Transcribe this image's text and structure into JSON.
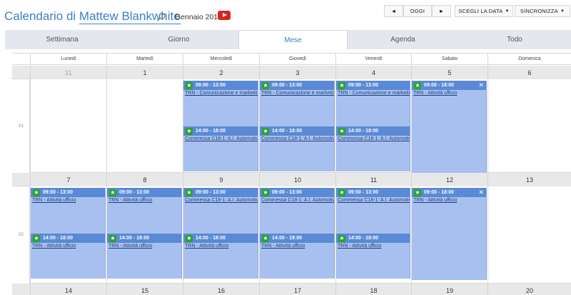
{
  "header": {
    "title_prefix": "Calendario di",
    "user_name": "Mattew Blankwhite",
    "month_label": "Gennaio 2019",
    "icons": {
      "search": "search-icon",
      "video": "youtube-icon"
    }
  },
  "toolbar": {
    "prev_label": "◄",
    "today_label": "OGGI",
    "next_label": "►",
    "pick_date_label": "SCEGLI LA DATA",
    "sync_label": "SINCRONIZZA",
    "caret": "▼"
  },
  "tabs": [
    {
      "label": "Settimana",
      "active": false
    },
    {
      "label": "Giorno",
      "active": false
    },
    {
      "label": "Mese",
      "active": true
    },
    {
      "label": "Agenda",
      "active": false
    },
    {
      "label": "Todo",
      "active": false
    }
  ],
  "weekdays": [
    "Lunedì",
    "Martedì",
    "Mercoledì",
    "Giovedì",
    "Venerdì",
    "Sabato",
    "Domenica"
  ],
  "weeks": [
    {
      "week_number": "01",
      "dates": [
        "31",
        "1",
        "2",
        "3",
        "4",
        "5",
        "6"
      ],
      "other_month": [
        true,
        false,
        false,
        false,
        false,
        false,
        false
      ],
      "events": {
        "2": [
          {
            "time": "09:00 - 13:00",
            "title": "TRN - Comunicazione e marketing"
          },
          {
            "time": "14:00 - 18:00",
            "title": "Commessa C18-1: A.I. Automotive"
          }
        ],
        "3": [
          {
            "time": "09:00 - 13:00",
            "title": "TRN - Comunicazione e marketing"
          },
          {
            "time": "14:00 - 18:00",
            "title": "Commessa C18-1: A.I. Automotive"
          }
        ],
        "4": [
          {
            "time": "09:00 - 13:00",
            "title": "TRN - Comunicazione e marketing"
          },
          {
            "time": "14:00 - 18:00",
            "title": "Commessa C18-1: A.I. Automotive"
          }
        ],
        "5": [
          {
            "time": "09:00 - 18:00",
            "title": "TRN - Attività ufficio",
            "allday": true
          }
        ]
      }
    },
    {
      "week_number": "02",
      "dates": [
        "7",
        "8",
        "9",
        "10",
        "11",
        "12",
        "13"
      ],
      "other_month": [
        false,
        false,
        false,
        false,
        false,
        false,
        false
      ],
      "events": {
        "0": [
          {
            "time": "09:00 - 13:00",
            "title": "TRN - Attività ufficio"
          },
          {
            "time": "14:00 - 18:00",
            "title": "TRN - Attività ufficio"
          }
        ],
        "1": [
          {
            "time": "09:00 - 13:00",
            "title": "TRN - Attività ufficio"
          },
          {
            "time": "14:00 - 18:00",
            "title": "TRN - Attività ufficio"
          }
        ],
        "2": [
          {
            "time": "09:00 - 13:00",
            "title": "Commessa C18-1: A.I. Automotive"
          },
          {
            "time": "14:00 - 18:00",
            "title": "TRN - Attività ufficio"
          }
        ],
        "3": [
          {
            "time": "09:00 - 13:00",
            "title": "Commessa C18-1: A.I. Automotive"
          },
          {
            "time": "14:00 - 18:00",
            "title": "TRN - Attività ufficio"
          }
        ],
        "4": [
          {
            "time": "09:00 - 13:00",
            "title": "Commessa C18-1: A.I. Automotive"
          },
          {
            "time": "14:00 - 18:00",
            "title": "TRN - Attività ufficio"
          }
        ],
        "5": [
          {
            "time": "09:00 - 18:00",
            "title": "TRN - Attività ufficio",
            "allday": true
          }
        ]
      }
    },
    {
      "week_number": "",
      "dates": [
        "14",
        "15",
        "16",
        "17",
        "18",
        "19",
        "20"
      ],
      "other_month": [
        false,
        false,
        false,
        false,
        false,
        false,
        false
      ],
      "events": {}
    }
  ],
  "colors": {
    "accent": "#3a7fc4",
    "event_bg": "#a8c0f0",
    "event_header": "#5a8ad6",
    "star": "#2aa32a",
    "date_bar": "#e8e8e8"
  }
}
